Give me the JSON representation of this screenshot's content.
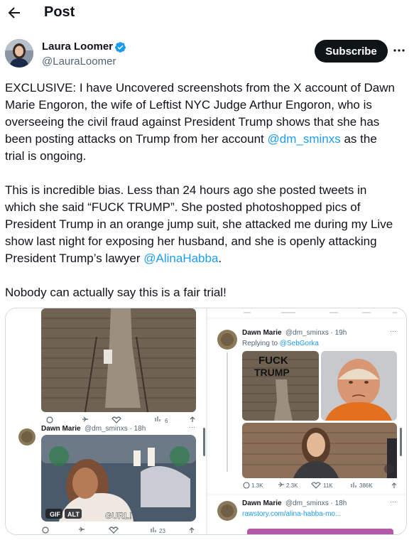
{
  "header": {
    "title": "Post"
  },
  "author": {
    "name": "Laura Loomer",
    "handle": "@LauraLoomer"
  },
  "actions": {
    "subscribe_label": "Subscribe"
  },
  "post": {
    "p1_a": "EXCLUSIVE: I have Uncovered screenshots from the X account of Dawn",
    "p1_b": "Marie Engoron, the wife of Leftist NYC Judge Arthur Engoron, who is",
    "p1_c": "overseeing the civil fraud  against President Trump shows that she has",
    "p1_d": "been posting attacks on Trump from her account",
    "p1_mention": "@dm_sminxs",
    "p1_e": " as the",
    "p1_f": "trial is ongoing.",
    "p2_a": "This is incredible bias. Less than 24 hours ago she posted tweets in",
    "p2_b": "which she said “FUCK TRUMP”. She posted photoshopped pics of",
    "p2_c": "President Trump in an orange jump suit, she attacked me during my Live",
    "p2_d": "show last night for exposing her husband, and she is openly  attacking",
    "p2_e": "President Trump’s lawyer ",
    "p2_mention": "@AlinaHabba",
    "p2_f": ".",
    "p3": "Nobody can actually say this is a fair trial!"
  },
  "screenshot_left": {
    "top_stats": {
      "replies": "",
      "reposts": "",
      "likes": "",
      "views": "6"
    },
    "tweet": {
      "name": "Dawn Marie",
      "meta": "@dm_sminxs · 18h",
      "gif_badge": "GIF",
      "alt_badge": "ALT",
      "caption": "GURL!",
      "views": "23"
    }
  },
  "screenshot_right": {
    "tweet1": {
      "name": "Dawn Marie",
      "meta": "@dm_sminxs · 19h",
      "replying_prefix": "Replying to ",
      "replying_to": "@SebGorka",
      "graffiti_1": "FUCK",
      "graffiti_2": "TRUMP",
      "replies": "1.3K",
      "reposts": "2.3K",
      "likes": "11K",
      "views": "386K"
    },
    "tweet2": {
      "name": "Dawn Marie",
      "meta": "@dm_sminxs · 18h",
      "link": "rawstory.com/alina-habba-mo..."
    }
  },
  "colors": {
    "accent": "#1d9bf0",
    "text": "#0f1419",
    "muted": "#536471",
    "verified": "#1d9bf0"
  }
}
